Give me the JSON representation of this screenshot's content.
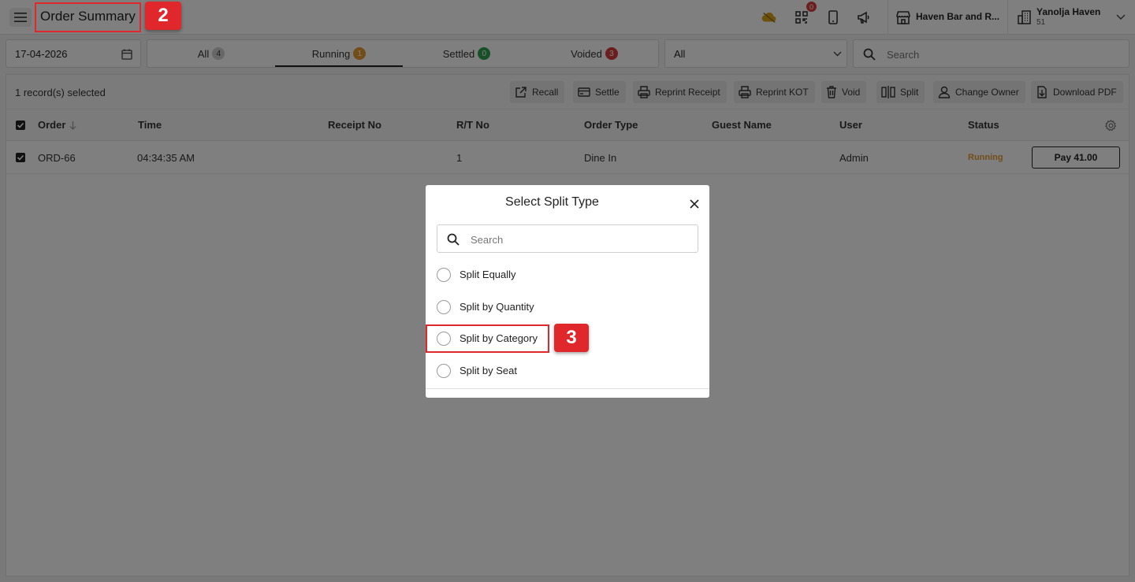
{
  "header": {
    "title": "Order Summary",
    "step_marker": "2",
    "notification_count": "0",
    "store_name": "Haven Bar and R...",
    "user_name": "Yanolja Haven",
    "user_sub": "51"
  },
  "filters": {
    "date": "17-04-2026",
    "tabs": [
      {
        "label": "All",
        "count": "4",
        "color": "#9e9e9e"
      },
      {
        "label": "Running",
        "count": "1",
        "color": "#e59a2f"
      },
      {
        "label": "Settled",
        "count": "0",
        "color": "#2e9e4f"
      },
      {
        "label": "Voided",
        "count": "3",
        "color": "#d83b3b"
      }
    ],
    "active_tab": "Running",
    "order_type_select": "All",
    "search_placeholder": "Search"
  },
  "actions": {
    "selected_text": "1 record(s) selected",
    "buttons": [
      "Recall",
      "Settle",
      "Reprint Receipt",
      "Reprint KOT",
      "Void",
      "Split",
      "Change Owner",
      "Download PDF"
    ]
  },
  "table": {
    "columns": [
      "Order",
      "Time",
      "Receipt No",
      "R/T No",
      "Order Type",
      "Guest Name",
      "User",
      "Status"
    ],
    "rows": [
      {
        "order": "ORD-66",
        "time": "04:34:35 AM",
        "receipt_no": "",
        "rt_no": "1",
        "order_type": "Dine In",
        "guest_name": "",
        "user": "Admin",
        "status": "Running",
        "pay_label": "Pay 41.00"
      }
    ]
  },
  "modal": {
    "title": "Select Split Type",
    "search_placeholder": "Search",
    "options": [
      "Split Equally",
      "Split by Quantity",
      "Split by Category",
      "Split by Seat"
    ],
    "step_marker": "3"
  }
}
